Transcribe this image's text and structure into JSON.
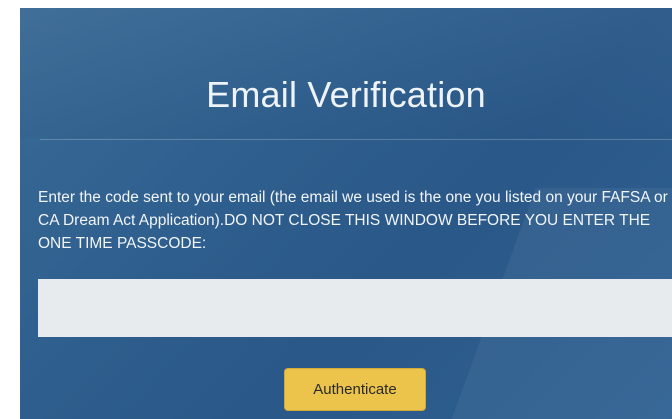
{
  "dialog": {
    "title": "Email Verification",
    "instructions": "Enter the code sent to your email (the email we used is the one you listed on your FAFSA or CA Dream Act Application).DO NOT CLOSE THIS WINDOW BEFORE YOU ENTER THE ONE TIME PASSCODE:",
    "code_input": {
      "value": "",
      "placeholder": ""
    },
    "authenticate_label": "Authenticate"
  },
  "colors": {
    "panel_background": "#2f5f8e",
    "button_background": "#ecc44c",
    "input_background": "#e8ebee",
    "text": "#f2f5f8"
  }
}
